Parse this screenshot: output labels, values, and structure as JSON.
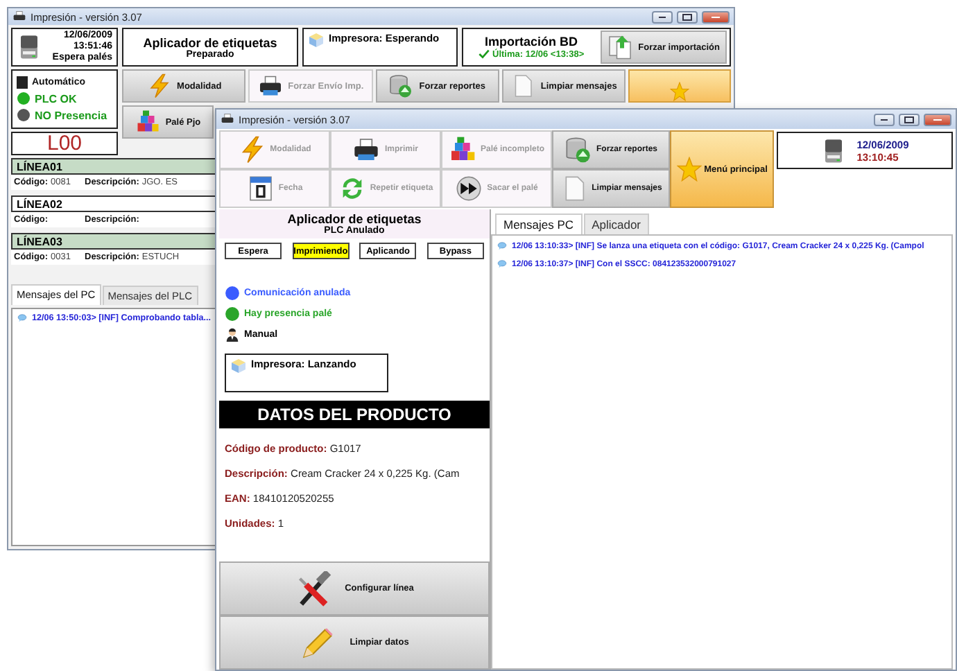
{
  "back_window": {
    "title": "Impresión - versión 3.07",
    "clock": {
      "date": "12/06/2009",
      "time": "13:51:46",
      "status": "Espera palés"
    },
    "applicator": {
      "title": "Aplicador de etiquetas",
      "status": "Preparado"
    },
    "printer": {
      "label": "Impresora: Esperando"
    },
    "import": {
      "title": "Importación BD",
      "last": "Última: 12/06 <13:38>",
      "button": "Forzar importación"
    },
    "indicators": [
      {
        "label": "Automático",
        "kind": "square",
        "color": "#222222"
      },
      {
        "label": "PLC OK",
        "kind": "led",
        "color": "#22b022"
      },
      {
        "label": "NO Presencia",
        "kind": "led",
        "color": "#555555"
      }
    ],
    "line_code": "L00",
    "toolbar": [
      {
        "label": "Modalidad",
        "kind": "bolt",
        "disabled": false
      },
      {
        "label": "Forzar Envío Imp.",
        "kind": "printer",
        "disabled": true
      },
      {
        "label": "Forzar reportes",
        "kind": "database",
        "disabled": false
      },
      {
        "label": "Limpiar mensajes",
        "kind": "page",
        "disabled": false
      },
      {
        "label": "Palé Pjo",
        "kind": "blocks",
        "disabled": false
      }
    ],
    "lines": [
      {
        "name": "LÍNEA01",
        "active": true,
        "code_label": "Código:",
        "code": "0081",
        "description_label": "Descripción:",
        "description": "JGO. ES"
      },
      {
        "name": "LÍNEA02",
        "active": false,
        "code_label": "Código:",
        "description_label": "Descripción:"
      },
      {
        "name": "LÍNEA03",
        "active": true,
        "code_label": "Código:",
        "code": "0031",
        "description_label": "Descripción:",
        "description": "ESTUCH"
      }
    ],
    "tabs": [
      {
        "label": "Mensajes del PC",
        "selected": true
      },
      {
        "label": "Mensajes del PLC",
        "selected": false
      }
    ],
    "messages": [
      {
        "text": "12/06 13:50:03> [INF] Comprobando tabla..."
      }
    ]
  },
  "front_window": {
    "title": "Impresión - versión 3.07",
    "toolbar": [
      {
        "label": "Modalidad",
        "kind": "bolt",
        "disabled": true
      },
      {
        "label": "Imprimir",
        "kind": "printer",
        "disabled": true
      },
      {
        "label": "Palé incompleto",
        "kind": "blocks",
        "disabled": true
      },
      {
        "label": "Forzar reportes",
        "kind": "database",
        "disabled": false
      },
      {
        "label": "Fecha",
        "kind": "calendar",
        "disabled": true
      },
      {
        "label": "Repetir etiqueta",
        "kind": "refresh",
        "disabled": true
      },
      {
        "label": "Sacar el palé",
        "kind": "forward",
        "disabled": true
      },
      {
        "label": "Limpiar mensajes",
        "kind": "page",
        "disabled": false
      }
    ],
    "main_menu": {
      "label": "Menú principal"
    },
    "clock": {
      "date": "12/06/2009",
      "time": "13:10:45"
    },
    "applicator": {
      "title": "Aplicador de etiquetas",
      "status": "PLC Anulado",
      "states": [
        {
          "label": "Espera",
          "selected": false
        },
        {
          "label": "Imprimiendo",
          "selected": true
        },
        {
          "label": "Aplicando",
          "selected": false
        },
        {
          "label": "Bypass",
          "selected": false
        }
      ],
      "indicators": [
        {
          "label": "Comunicación anulada",
          "kind": "led",
          "color": "#3a5cff"
        },
        {
          "label": "Hay presencia palé",
          "kind": "led",
          "color": "#2aa52a"
        },
        {
          "label": "Manual",
          "kind": "person"
        }
      ],
      "printer": {
        "label": "Impresora: Lanzando"
      }
    },
    "product": {
      "title": "DATOS DEL PRODUCTO",
      "fields": [
        {
          "label": "Código de producto:",
          "value": "G1017"
        },
        {
          "label": "Descripción:",
          "value": "Cream Cracker 24 x 0,225 Kg. (Cam"
        },
        {
          "label": "EAN:",
          "value": "18410120520255"
        },
        {
          "label": "Unidades:",
          "value": "1"
        }
      ]
    },
    "actions": [
      {
        "label": "Configurar línea",
        "kind": "tools"
      },
      {
        "label": "Limpiar datos",
        "kind": "pencil"
      }
    ],
    "tabs": [
      {
        "label": "Mensajes PC",
        "selected": true
      },
      {
        "label": "Aplicador",
        "selected": false
      }
    ],
    "messages": [
      {
        "text": "12/06 13:10:33> [INF] Se lanza una etiqueta con el código: G1017, Cream Cracker 24 x 0,225 Kg. (Campol"
      },
      {
        "text": "12/06 13:10:37> [INF] Con el SSCC: 084123532000791027"
      }
    ]
  }
}
